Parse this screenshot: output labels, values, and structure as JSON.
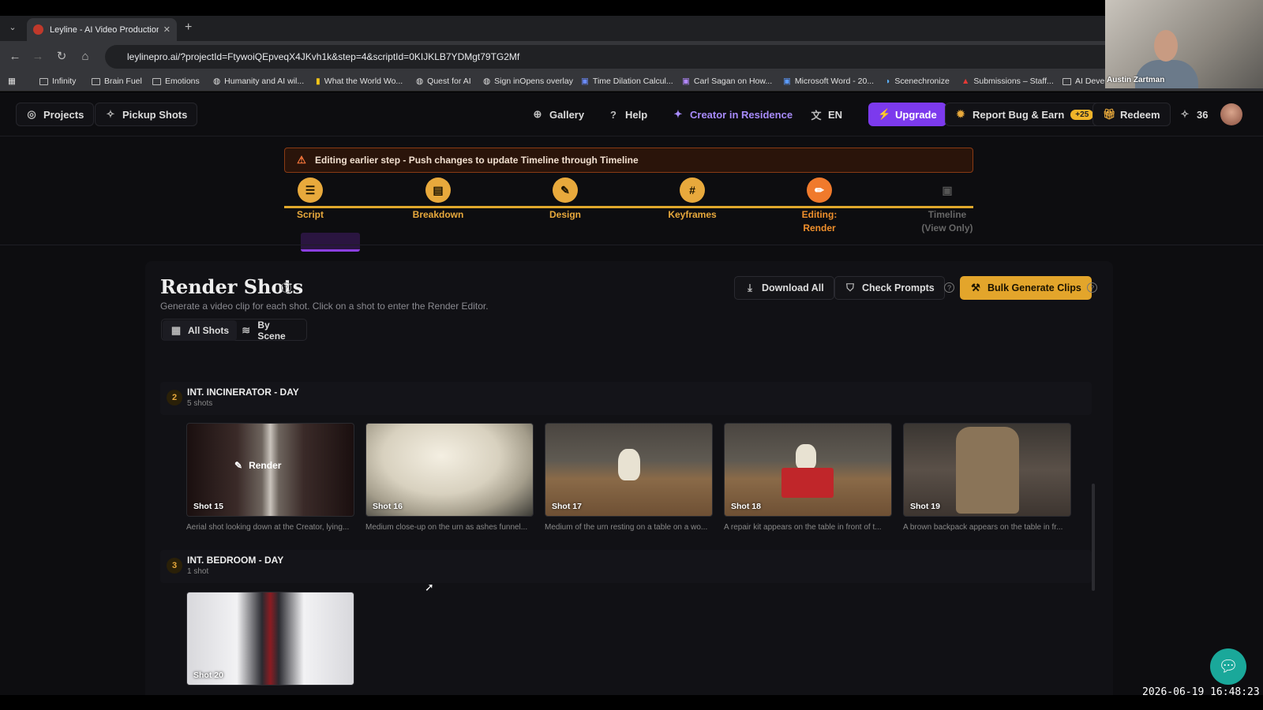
{
  "browser": {
    "tab_title": "Leyline - AI Video Production F",
    "url": "leylinepro.ai/?projectId=FtywoiQEpveqX4JKvh1k&step=4&scriptId=0KIJKLB7YDMgt79TG2Mf",
    "bookmarks": [
      "Infinity",
      "Brain Fuel",
      "Emotions",
      "Humanity and AI wil...",
      "What the World Wo...",
      "Quest for AI",
      "Sign inOpens overlay",
      "Time Dilation Calcul...",
      "Carl Sagan on How...",
      "Microsoft Word - 20...",
      "Scenechronize",
      "Submissions – Staff...",
      "AI Deve"
    ]
  },
  "webcam": {
    "name": "Austin Zartman"
  },
  "nav": {
    "projects": "Projects",
    "pickup": "Pickup Shots",
    "gallery": "Gallery",
    "help": "Help",
    "creator": "Creator in Residence",
    "lang": "EN",
    "upgrade": "Upgrade",
    "report": "Report Bug & Earn",
    "report_badge": "+25",
    "redeem": "Redeem",
    "credits": "36"
  },
  "warning": "Editing earlier step - Push changes to update Timeline through Timeline",
  "steps": [
    {
      "label": "Script"
    },
    {
      "label": "Breakdown"
    },
    {
      "label": "Design"
    },
    {
      "label": "Keyframes"
    },
    {
      "label": "Editing:",
      "label2": "Render"
    },
    {
      "label": "Timeline",
      "label2": "(View Only)"
    }
  ],
  "header": {
    "title": "Render Shots",
    "subtitle": "Generate a video clip for each shot. Click on a shot to enter the Render Editor.",
    "download": "Download All",
    "check": "Check Prompts",
    "bulk": "Bulk Generate Clips"
  },
  "view_toggle": {
    "all": "All Shots",
    "scene": "By Scene"
  },
  "scenes": [
    {
      "num": "2",
      "title": "INT. INCINERATOR - DAY",
      "count": "5 shots",
      "shots": [
        {
          "label": "Shot 15",
          "desc": "Aerial shot looking down at the Creator, lying...",
          "overlay": "Render"
        },
        {
          "label": "Shot 16",
          "desc": "Medium close-up on the urn as ashes funnel..."
        },
        {
          "label": "Shot 17",
          "desc": "Medium of the urn resting on a table on a wo..."
        },
        {
          "label": "Shot 18",
          "desc": "A repair kit appears on the table in front of t..."
        },
        {
          "label": "Shot 19",
          "desc": "A brown backpack appears on the table in fr..."
        }
      ]
    },
    {
      "num": "3",
      "title": "INT. BEDROOM - DAY",
      "count": "1 shot",
      "shots": [
        {
          "label": "Shot 20",
          "desc": ""
        }
      ]
    }
  ],
  "timestamp": "2026-06-19 16:48:23"
}
